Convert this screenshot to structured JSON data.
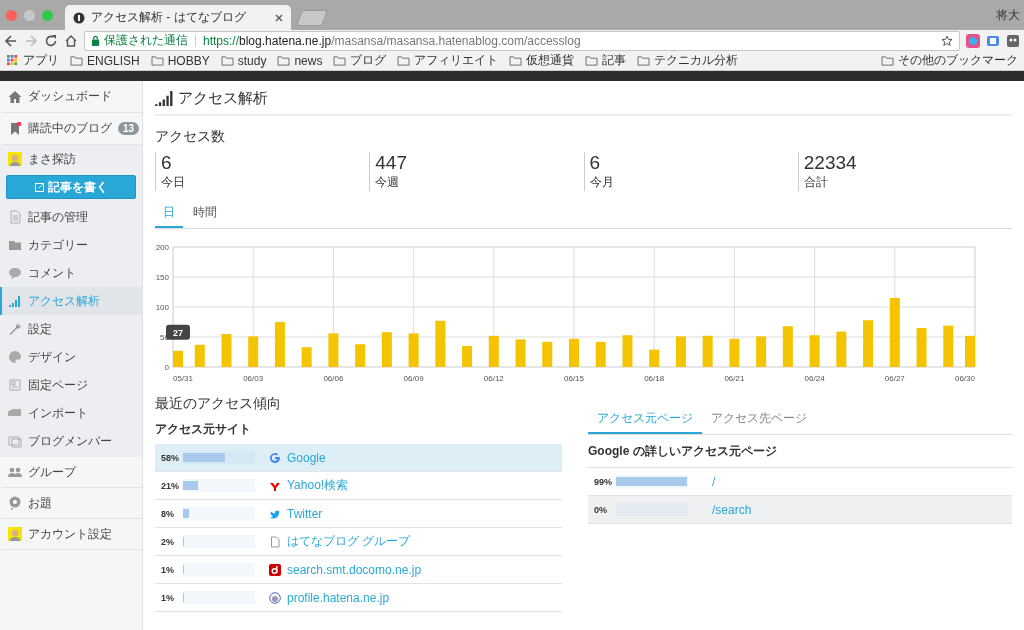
{
  "browser": {
    "tab_title": "アクセス解析 - はてなブログ",
    "profile_name": "将大",
    "secure_label": "保護された通信",
    "url_scheme": "https://",
    "url_host": "blog.hatena.ne.jp",
    "url_path": "/masansa/masansa.hatenablog.com/accesslog",
    "bookmarks": [
      {
        "label": "アプリ",
        "kind": "apps"
      },
      {
        "label": "ENGLISH",
        "kind": "folder"
      },
      {
        "label": "HOBBY",
        "kind": "folder"
      },
      {
        "label": "study",
        "kind": "folder"
      },
      {
        "label": "news",
        "kind": "folder"
      },
      {
        "label": "ブログ",
        "kind": "folder"
      },
      {
        "label": "アフィリエイト",
        "kind": "folder"
      },
      {
        "label": "仮想通貨",
        "kind": "folder"
      },
      {
        "label": "記事",
        "kind": "folder"
      },
      {
        "label": "テクニカル分析",
        "kind": "folder"
      }
    ],
    "other_bookmarks": "その他のブックマーク"
  },
  "sidebar": {
    "top_items": [
      {
        "label": "ダッシュボード",
        "selected": false
      },
      {
        "label": "購読中のブログ",
        "badge": "13",
        "selected": false
      }
    ],
    "blog_name": "まさ探訪",
    "write_button": "記事を書く",
    "blog_items": [
      {
        "label": "記事の管理",
        "selected": false
      },
      {
        "label": "カテゴリー",
        "selected": false
      },
      {
        "label": "コメント",
        "selected": false
      },
      {
        "label": "アクセス解析",
        "selected": true
      },
      {
        "label": "設定",
        "selected": false
      },
      {
        "label": "デザイン",
        "selected": false
      },
      {
        "label": "固定ページ",
        "selected": false
      },
      {
        "label": "インポート",
        "selected": false
      },
      {
        "label": "ブログメンバー",
        "selected": false
      }
    ],
    "bottom_items": [
      {
        "label": "グループ",
        "selected": false
      },
      {
        "label": "お題",
        "selected": false
      },
      {
        "label": "アカウント設定",
        "selected": false
      }
    ]
  },
  "page_title": "アクセス解析",
  "access_heading": "アクセス数",
  "stats": [
    {
      "value": "6",
      "label": "今日"
    },
    {
      "value": "447",
      "label": "今週"
    },
    {
      "value": "6",
      "label": "今月"
    },
    {
      "value": "22334",
      "label": "合計"
    }
  ],
  "period_tabs": [
    {
      "label": "日",
      "selected": true
    },
    {
      "label": "時間",
      "selected": false
    }
  ],
  "chart_data": {
    "type": "bar",
    "categories": [
      "05/31",
      null,
      null,
      "06/03",
      null,
      null,
      "06/06",
      null,
      null,
      "06/09",
      null,
      null,
      "06/12",
      null,
      null,
      "06/15",
      null,
      null,
      "06/18",
      null,
      null,
      "06/21",
      null,
      null,
      "06/24",
      null,
      null,
      "06/27",
      null,
      null,
      "06/30"
    ],
    "series": [
      {
        "color": "#f4c400",
        "values": [
          27,
          37,
          55,
          51,
          75,
          33,
          56,
          38,
          58,
          56,
          77,
          35,
          52,
          46,
          42,
          47,
          42,
          53,
          29,
          51,
          52,
          47,
          51,
          68,
          53,
          59,
          78,
          115,
          65,
          69,
          52
        ]
      }
    ],
    "ylim": [
      0,
      200
    ],
    "yticks": [
      0,
      50,
      100,
      150,
      200
    ],
    "grid": true,
    "annotations": [
      "27"
    ]
  },
  "trend_heading": "最近のアクセス傾向",
  "sources": {
    "heading": "アクセス元サイト",
    "rows": [
      {
        "percent": "58%",
        "level": 0.58,
        "kind": "google",
        "name": "Google",
        "selected": true
      },
      {
        "percent": "21%",
        "level": 0.21,
        "kind": "yahoo",
        "name": "Yahoo!検索",
        "selected": false
      },
      {
        "percent": "8%",
        "level": 0.08,
        "kind": "twitter",
        "name": "Twitter",
        "selected": false
      },
      {
        "percent": "2%",
        "level": 0.02,
        "kind": "page",
        "name": "はてなブログ グループ",
        "selected": false
      },
      {
        "percent": "1%",
        "level": 0.01,
        "kind": "docomo",
        "name": "search.smt.docomo.ne.jp",
        "selected": false
      },
      {
        "percent": "1%",
        "level": 0.01,
        "kind": "hatena",
        "name": "profile.hatena.ne.jp",
        "selected": false
      }
    ]
  },
  "pages": {
    "tabs": [
      {
        "label": "アクセス元ページ",
        "selected": true
      },
      {
        "label": "アクセス先ページ",
        "selected": false
      }
    ],
    "heading": "Google の詳しいアクセス元ページ",
    "rows": [
      {
        "percent": "99%",
        "level": 0.99,
        "path": "/",
        "highlighted": false
      },
      {
        "percent": "0%",
        "path": "/search",
        "highlighted": true
      }
    ]
  }
}
